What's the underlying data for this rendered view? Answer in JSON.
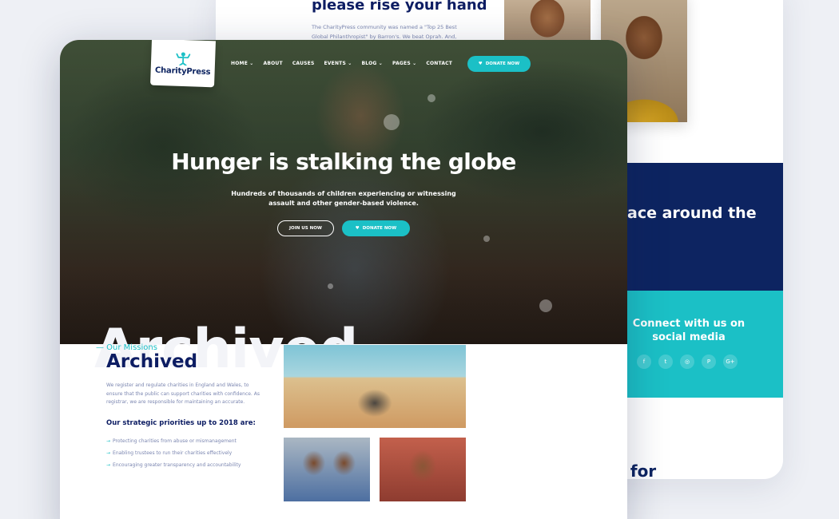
{
  "back": {
    "heading": "please rise your hand",
    "para": "The CharityPress community was named a \"Top 25 Best Global Philanthropist\" by Barron's. We beat Oprah. And, Mashable named",
    "navy_text": "ace around the",
    "social_title": "Connect with us on social media",
    "social_icons": [
      "f",
      "t",
      "◎",
      "P",
      "G+"
    ],
    "for_text": "s for"
  },
  "brand": {
    "name": "CharityPress",
    "accent": "#1bc0c6",
    "navy": "#0d1d63"
  },
  "nav": {
    "items": [
      "HOME ⌄",
      "ABOUT",
      "CAUSES",
      "EVENTS ⌄",
      "BLOG ⌄",
      "PAGES ⌄",
      "CONTACT"
    ],
    "donate": "DONATE NOW"
  },
  "hero": {
    "title": "Hunger is stalking the globe",
    "subtitle": "Hundreds of thousands of children experiencing or witnessing assault and other gender-based violence.",
    "join": "JOIN US NOW",
    "donate": "DONATE NOW"
  },
  "missions": {
    "bg_word": "Archived",
    "label": "— Our Missions",
    "title": "Archived",
    "para": "We register and regulate charities in England and Wales, to ensure that the public can support charities with confidence. As registrar, we are responsible for maintaining an accurate.",
    "priorities_title": "Our strategic priorities up to 2018 are:",
    "priorities": [
      "Protecting charities from abuse or mismanagement",
      "Enabling trustees to run their charities effectively",
      "Encouraging greater transparency and accountability"
    ]
  }
}
